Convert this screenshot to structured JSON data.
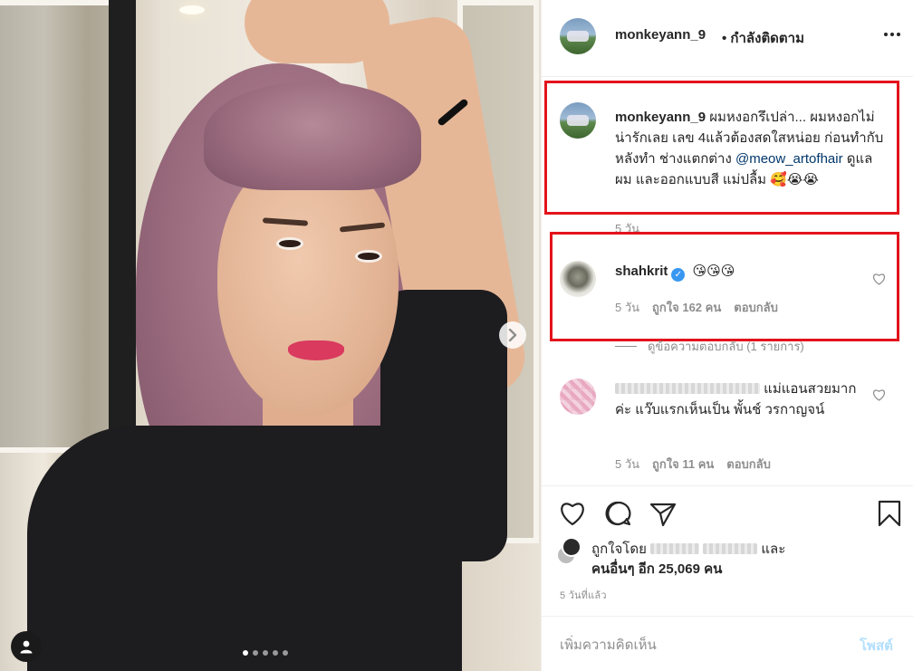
{
  "header": {
    "username": "monkeyann_9",
    "follow_label": "• กำลังติดตาม"
  },
  "caption": {
    "username": "monkeyann_9",
    "text_before_mention": "ผมหงอกรึเปล่า... ผมหงอกไม่น่ารักเลย เลข 4แล้วต้องสดใสหน่อย ก่อนทำกับ หลังทำ ช่างแตกต่าง",
    "mention": "@meow_artofhair",
    "text_after_mention": "ดูแลผม และออกแบบสี แม่ปลื้ม 🥰😭😭",
    "time": "5 วัน"
  },
  "comments": [
    {
      "username": "shahkrit",
      "verified": true,
      "text": "😘😘😘",
      "time": "5 วัน",
      "likes": "ถูกใจ 162 คน",
      "reply_label": "ตอบกลับ",
      "view_replies": "ดูข้อความตอบกลับ (1 รายการ)"
    },
    {
      "username": "",
      "text": "แม่แอนสวยมากค่ะ แว๊บแรกเห็นเป็น พั้นช์ วรกาญจน์",
      "time": "5 วัน",
      "likes": "ถูกใจ 11 คน",
      "reply_label": "ตอบกลับ"
    }
  ],
  "likes": {
    "prefix": "ถูกใจโดย",
    "conjunction": "และ",
    "others": "คนอื่นๆ อีก 25,069 คน"
  },
  "timestamp": "5 วันที่แล้ว",
  "comment_box": {
    "placeholder": "เพิ่มความคิดเห็น",
    "post_label": "โพสต์"
  },
  "carousel": {
    "total": 5,
    "active_index": 0
  },
  "colors": {
    "highlight_box": "#e3131b",
    "link": "#00376b",
    "verified": "#3897f0",
    "post_disabled": "#b2dffc"
  }
}
